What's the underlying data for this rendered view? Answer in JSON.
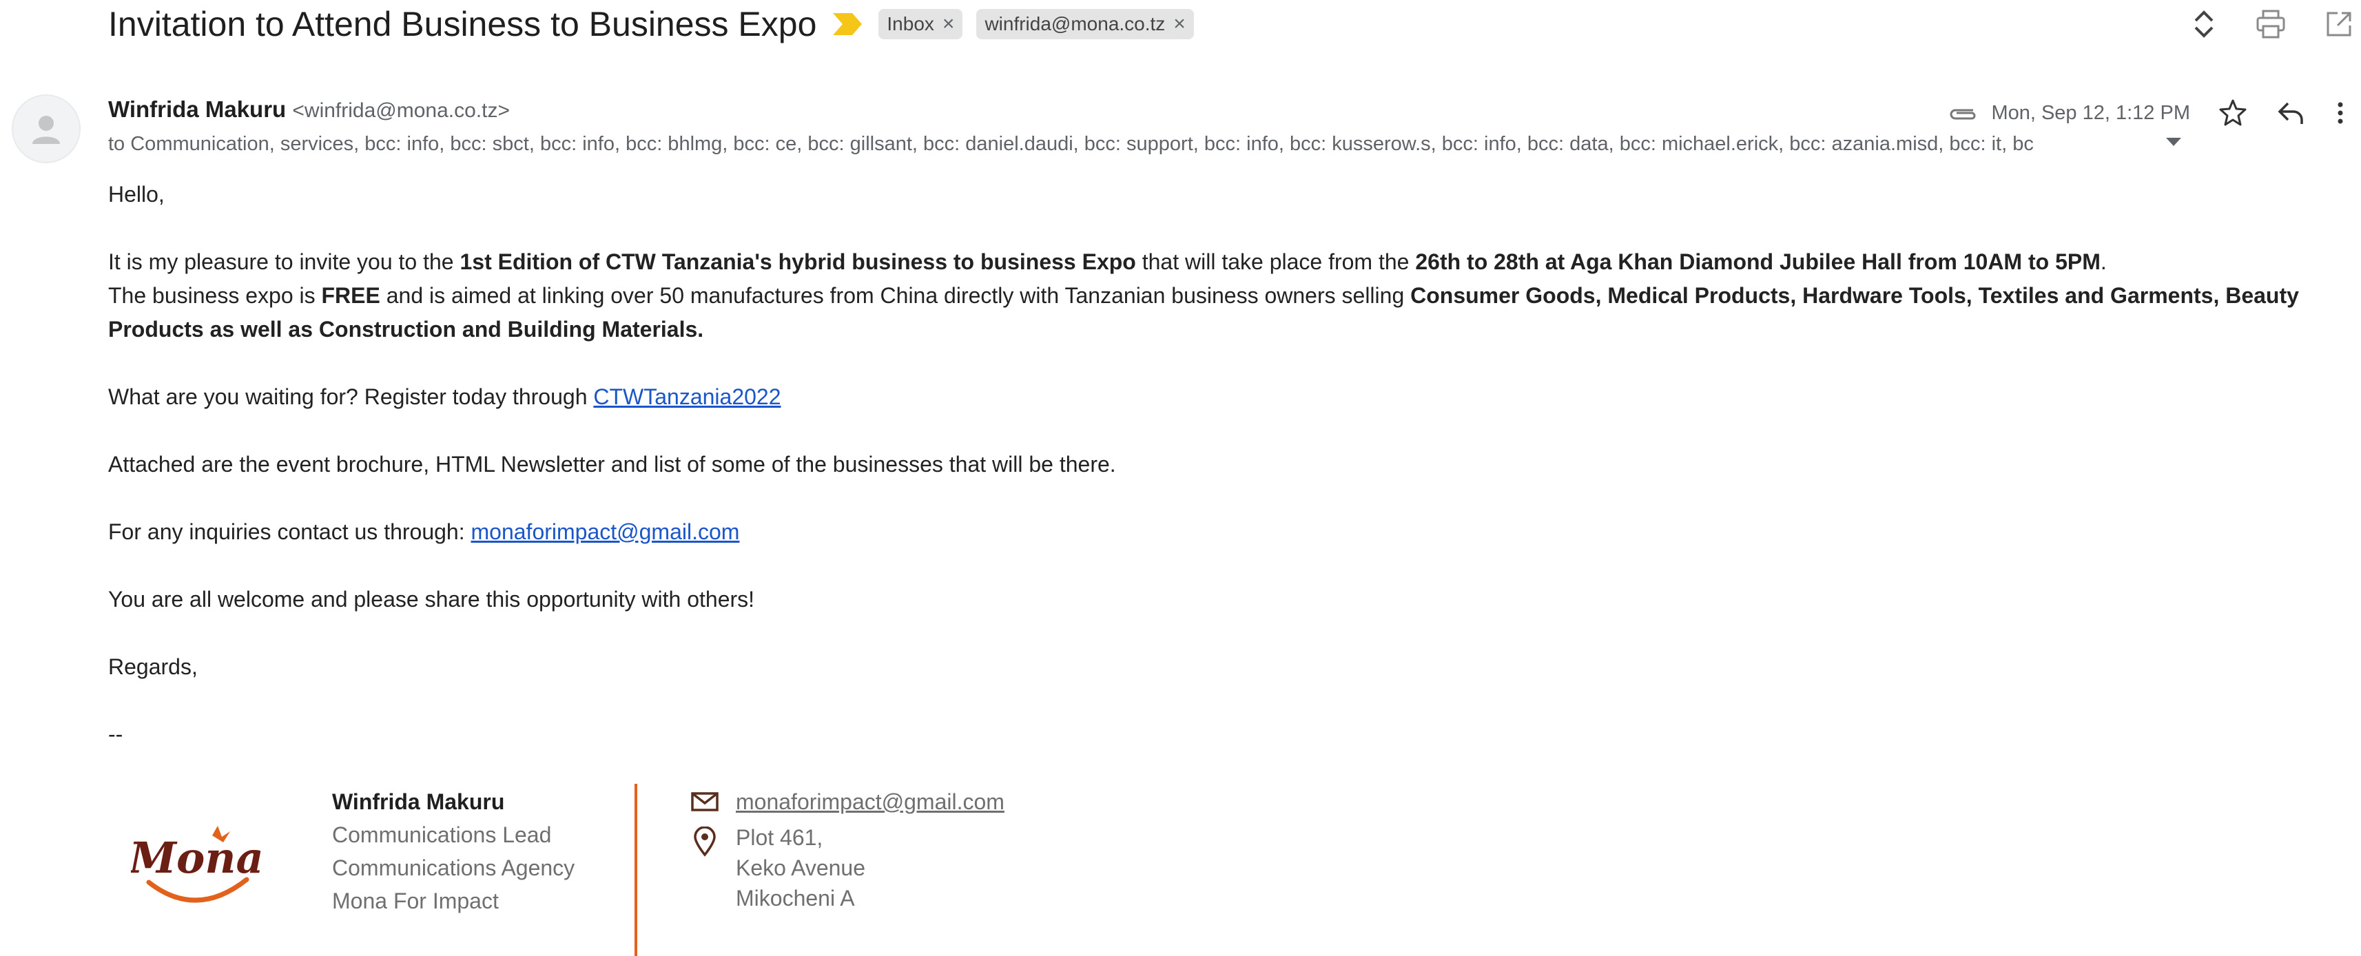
{
  "subject": {
    "title": "Invitation to Attend Business to Business Expo",
    "importance_icon": "importance-marker-icon",
    "labels": [
      {
        "text": "Inbox",
        "remove": "×"
      },
      {
        "text": "winfrida@mona.co.tz",
        "remove": "×"
      }
    ]
  },
  "top_actions": [
    "expand-collapse-icon",
    "print-icon",
    "open-new-window-icon"
  ],
  "sender": {
    "name": "Winfrida Makuru",
    "email": "<winfrida@mona.co.tz>",
    "recipients": "to Communication, services, bcc: info, bcc: sbct, bcc: info, bcc: bhlmg, bcc: ce, bcc: gillsant, bcc: daniel.daudi, bcc: support, bcc: info, bcc: kusserow.s, bcc: info, bcc: data, bcc: michael.erick, bcc: azania.misd, bcc: it, bc"
  },
  "meta": {
    "date": "Mon, Sep 12, 1:12 PM",
    "icons": [
      "attachment-icon",
      "star-icon",
      "reply-icon",
      "more-vert-icon"
    ]
  },
  "body": {
    "greeting": "Hello,",
    "p1_a": "It is my pleasure to invite you to the ",
    "p1_b": "1st Edition of CTW Tanzania's hybrid business to business Expo",
    "p1_c": " that will take place from the ",
    "p1_d": "26th to 28th at Aga Khan Diamond Jubilee Hall from 10AM to 5PM",
    "p1_e": ".",
    "p2_a": "The business expo is ",
    "p2_b": "FREE",
    "p2_c": " and is aimed at linking over 50 manufactures from China directly with Tanzanian business owners selling ",
    "p2_d": "Consumer Goods, Medical Products, Hardware Tools, Textiles and Garments, Beauty Products as well as Construction and Building Materials.",
    "p3_a": "What are you waiting for? Register today through ",
    "p3_link": "CTWTanzania2022",
    "p4": "Attached are the event brochure, HTML Newsletter and list of some of the businesses that will be there.",
    "p5_a": "For any inquiries contact us through: ",
    "p5_link": "monaforimpact@gmail.com",
    "p6": "You are all welcome and please share this opportunity with others!",
    "regards": "Regards,",
    "dashes": "--"
  },
  "signature": {
    "logo_text": "Mona",
    "name": "Winfrida Makuru",
    "title": "Communications Lead",
    "agency": "Communications Agency",
    "org": "Mona For Impact",
    "email": "monaforimpact@gmail.com",
    "address_1": "Plot 461,",
    "address_2": "Keko Avenue",
    "address_3": "Mikocheni A",
    "accent_color": "#e2621b"
  }
}
